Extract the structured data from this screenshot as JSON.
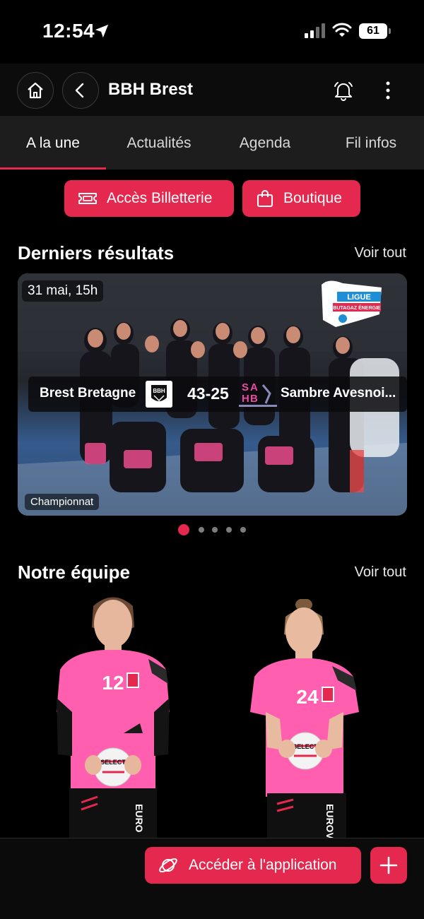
{
  "status_bar": {
    "time": "12:54",
    "battery": "61"
  },
  "header": {
    "title": "BBH Brest"
  },
  "tabs": [
    {
      "label": "A la une",
      "active": true
    },
    {
      "label": "Actualités",
      "active": false
    },
    {
      "label": "Agenda",
      "active": false
    },
    {
      "label": "Fil infos",
      "active": false
    }
  ],
  "quick_actions": {
    "ticketing": "Accès Billetterie",
    "shop": "Boutique"
  },
  "results": {
    "title": "Derniers résultats",
    "see_all": "Voir tout",
    "card": {
      "date": "31 mai, 15h",
      "home_team": "Brest Bretagne",
      "score": "43-25",
      "away_team": "Sambre Avesnoi...",
      "competition": "Championnat",
      "league_logo_text": "LIGUE BUTAGAZ ÉNERGIE",
      "home_logo_text": "BBH"
    },
    "carousel": {
      "count": 5,
      "active_index": 0
    }
  },
  "team": {
    "title": "Notre équipe",
    "see_all": "Voir tout",
    "players": [
      {
        "number": "12"
      },
      {
        "number": "24"
      }
    ]
  },
  "bottom": {
    "access_label": "Accéder à l'application"
  },
  "colors": {
    "accent": "#e5284e",
    "background": "#000000",
    "tabs_bg": "#1d1d1d",
    "jersey": "#ff5fae"
  }
}
